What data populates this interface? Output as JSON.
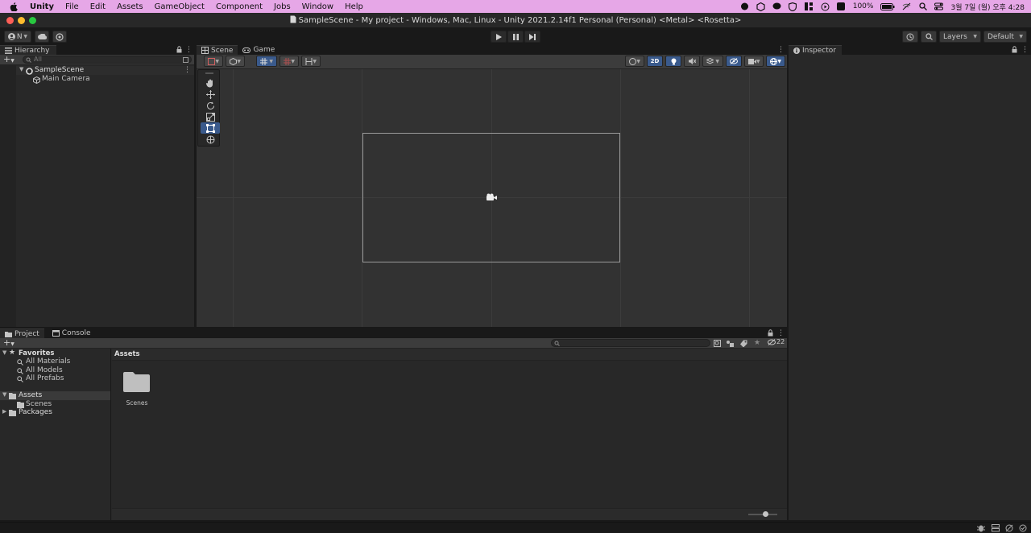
{
  "menubar": {
    "app_name": "Unity",
    "items": [
      "File",
      "Edit",
      "Assets",
      "GameObject",
      "Component",
      "Jobs",
      "Window",
      "Help"
    ],
    "battery": "100%",
    "clock": "3월 7일 (월) 오후 4:28"
  },
  "window": {
    "title": "SampleScene - My project - Windows, Mac, Linux - Unity 2021.2.14f1 Personal (Personal) <Metal> <Rosetta>"
  },
  "toolbar": {
    "account_label": "N",
    "layers_label": "Layers",
    "layout_label": "Default"
  },
  "hierarchy": {
    "tab_label": "Hierarchy",
    "search_placeholder": "All",
    "scene_name": "SampleScene",
    "items": [
      "Main Camera"
    ]
  },
  "scene_view": {
    "tabs": [
      "Scene",
      "Game"
    ],
    "toggle_2d_label": "2D"
  },
  "inspector": {
    "tab_label": "Inspector"
  },
  "project": {
    "tabs": [
      "Project",
      "Console"
    ],
    "favorites_label": "Favorites",
    "favorites": [
      "All Materials",
      "All Models",
      "All Prefabs"
    ],
    "assets_label": "Assets",
    "assets_children": [
      "Scenes"
    ],
    "packages_label": "Packages",
    "breadcrumb": "Assets",
    "hidden_count": "22",
    "folders": [
      "Scenes"
    ]
  },
  "colors": {
    "menubar_bg": "#e6a7e7",
    "panel_bg": "#282828",
    "scene_bg": "#323232",
    "accent_blue": "#3a5a8c"
  }
}
